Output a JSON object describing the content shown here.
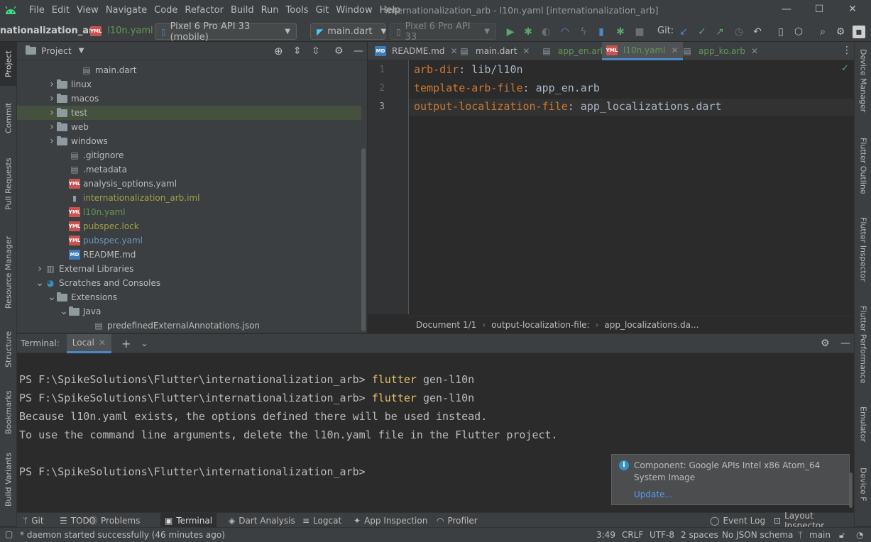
{
  "menubar": {
    "menus": [
      "File",
      "Edit",
      "View",
      "Navigate",
      "Code",
      "Refactor",
      "Build",
      "Run",
      "Tools",
      "Git",
      "Window",
      "Help"
    ],
    "title": "internationalization_arb - l10n.yaml [internationalization_arb]"
  },
  "toolbar": {
    "project_name": "nationalization_arb",
    "file_crumb": "l10n.yaml",
    "device": "Pixel 6 Pro API 33 (mobile)",
    "run_config": "main.dart",
    "emulator": "Pixel 6 Pro API 33",
    "git_label": "Git:"
  },
  "left_tabs": [
    "Project",
    "Commit",
    "Pull Requests",
    "Resource Manager",
    "Structure",
    "Bookmarks",
    "Build Variants"
  ],
  "right_tabs": [
    "Device Manager",
    "Flutter Outline",
    "Flutter Inspector",
    "Flutter Performance",
    "Emulator",
    "Device F"
  ],
  "project_panel": {
    "title": "Project",
    "tree": [
      {
        "label": "main.dart",
        "icon": "dart-file-icon",
        "indent": 4,
        "color": "#bbbbbb"
      },
      {
        "label": "linux",
        "icon": "folder-icon",
        "indent": 2,
        "chevron": "›",
        "color": "#bbbbbb"
      },
      {
        "label": "macos",
        "icon": "folder-icon",
        "indent": 2,
        "chevron": "›",
        "color": "#bbbbbb"
      },
      {
        "label": "test",
        "icon": "folder-icon",
        "indent": 2,
        "chevron": "›",
        "color": "#bbbbbb",
        "selected": true
      },
      {
        "label": "web",
        "icon": "folder-icon",
        "indent": 2,
        "chevron": "›",
        "color": "#bbbbbb"
      },
      {
        "label": "windows",
        "icon": "folder-icon",
        "indent": 2,
        "chevron": "›",
        "color": "#bbbbbb"
      },
      {
        "label": ".gitignore",
        "icon": "doc-icon",
        "indent": 3,
        "color": "#bbbbbb"
      },
      {
        "label": ".metadata",
        "icon": "doc-icon",
        "indent": 3,
        "color": "#bbbbbb"
      },
      {
        "label": "analysis_options.yaml",
        "icon": "yaml-icon",
        "indent": 3,
        "color": "#bbbbbb"
      },
      {
        "label": "internationalization_arb.iml",
        "icon": "iml-icon",
        "indent": 3,
        "color": "#a2a043"
      },
      {
        "label": "l10n.yaml",
        "icon": "yaml-icon",
        "indent": 3,
        "color": "#629755"
      },
      {
        "label": "pubspec.lock",
        "icon": "yaml-icon",
        "indent": 3,
        "color": "#a2a043"
      },
      {
        "label": "pubspec.yaml",
        "icon": "yaml-icon",
        "indent": 3,
        "color": "#6897bb"
      },
      {
        "label": "README.md",
        "icon": "md-icon",
        "indent": 3,
        "color": "#bbbbbb"
      },
      {
        "label": "External Libraries",
        "icon": "library-icon",
        "indent": 1,
        "chevron": "›",
        "color": "#bbbbbb"
      },
      {
        "label": "Scratches and Consoles",
        "icon": "scratch-icon",
        "indent": 1,
        "chevron": "⌄",
        "color": "#bbbbbb"
      },
      {
        "label": "Extensions",
        "icon": "folder-icon",
        "indent": 2,
        "chevron": "⌄",
        "color": "#bbbbbb"
      },
      {
        "label": "Java",
        "icon": "folder-icon",
        "indent": 3,
        "chevron": "⌄",
        "color": "#bbbbbb"
      },
      {
        "label": "predefinedExternalAnnotations.json",
        "icon": "json-icon",
        "indent": 5,
        "color": "#bbbbbb"
      }
    ]
  },
  "editor": {
    "tabs": [
      {
        "label": "README.md",
        "icon": "md-icon",
        "color": "#bbbbbb"
      },
      {
        "label": "main.dart",
        "icon": "dart-file-icon",
        "color": "#bbbbbb"
      },
      {
        "label": "app_en.arb",
        "icon": "arb-icon",
        "color": "#629755"
      },
      {
        "label": "l10n.yaml",
        "icon": "yaml-icon",
        "color": "#629755",
        "active": true
      },
      {
        "label": "app_ko.arb",
        "icon": "arb-icon",
        "color": "#629755"
      }
    ],
    "lines": [
      {
        "num": "1",
        "key": "arb-dir",
        "value": " lib/l10n"
      },
      {
        "num": "2",
        "key": "template-arb-file",
        "value": " app_en.arb"
      },
      {
        "num": "3",
        "key": "output-localization-file",
        "value": " app_localizations.dart"
      }
    ],
    "breadcrumb": [
      "Document 1/1",
      "output-localization-file:",
      "app_localizations.da..."
    ]
  },
  "terminal": {
    "label": "Terminal:",
    "tab": "Local",
    "lines": [
      {
        "prompt": "PS F:\\SpikeSolutions\\Flutter\\internationalization_arb> ",
        "cmd": "flutter",
        "rest": " gen-l10n"
      },
      {
        "prompt": "PS F:\\SpikeSolutions\\Flutter\\internationalization_arb> ",
        "cmd": "flutter",
        "rest": " gen-l10n"
      },
      {
        "prompt": "Because l10n.yaml exists, the options defined there will be used instead.",
        "cmd": "",
        "rest": ""
      },
      {
        "prompt": "To use the command line arguments, delete the l10n.yaml file in the Flutter project.",
        "cmd": "",
        "rest": ""
      },
      {
        "prompt": "",
        "cmd": "",
        "rest": ""
      },
      {
        "prompt": "PS F:\\SpikeSolutions\\Flutter\\internationalization_arb> ",
        "cmd": "",
        "rest": ""
      }
    ]
  },
  "notification": {
    "line1": "Component: Google APIs Intel x86 Atom_64",
    "line2": "System Image",
    "link": "Update..."
  },
  "bottom_tabs": [
    "Git",
    "TODO",
    "Problems",
    "Terminal",
    "Dart Analysis",
    "Logcat",
    "App Inspection",
    "Profiler",
    "Event Log",
    "Layout Inspector"
  ],
  "status": {
    "message": "* daemon started successfully (46 minutes ago)",
    "position": "3:49",
    "line_sep": "CRLF",
    "encoding": "UTF-8",
    "indent": "2 spaces",
    "schema": "No JSON schema",
    "branch": "main"
  },
  "colors": {
    "yaml_key": "#cc7832",
    "terminal_cmd": "#e8bf6a",
    "link": "#589df6"
  }
}
